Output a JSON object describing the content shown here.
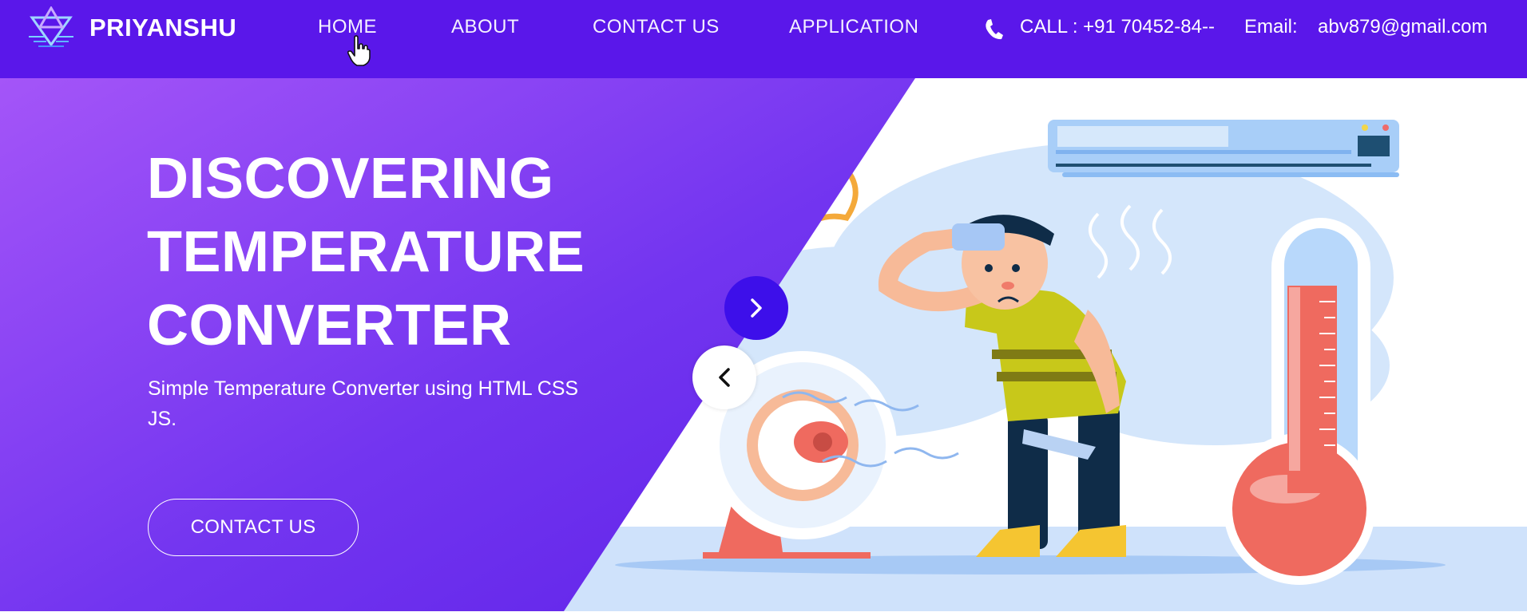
{
  "brand": {
    "name": "PRIYANSHU"
  },
  "nav": {
    "items": [
      {
        "label": "HOME"
      },
      {
        "label": "ABOUT"
      },
      {
        "label": "CONTACT US"
      },
      {
        "label": "APPLICATION"
      }
    ],
    "call": "CALL : +91 70452-84--",
    "email_label": "Email:",
    "email_value": "abv879@gmail.com"
  },
  "hero": {
    "title_lines": [
      "DISCOVERING",
      "TEMPERATURE",
      "CONVERTER"
    ],
    "subtitle": "Simple Temperature Converter using HTML CSS JS.",
    "cta_label": "CONTACT US"
  },
  "icons": {
    "logo": "brand-logo-icon",
    "phone": "phone-icon",
    "cursor": "hand-cursor-icon",
    "next": "chevron-right-icon",
    "prev": "chevron-left-icon"
  },
  "colors": {
    "nav_bg": "#5a17ea",
    "hero_gradient_start": "#9f55f7",
    "hero_gradient_end": "#5d25ea",
    "next_button": "#3d0fea",
    "illustration_bg": "#d4e6fb"
  }
}
